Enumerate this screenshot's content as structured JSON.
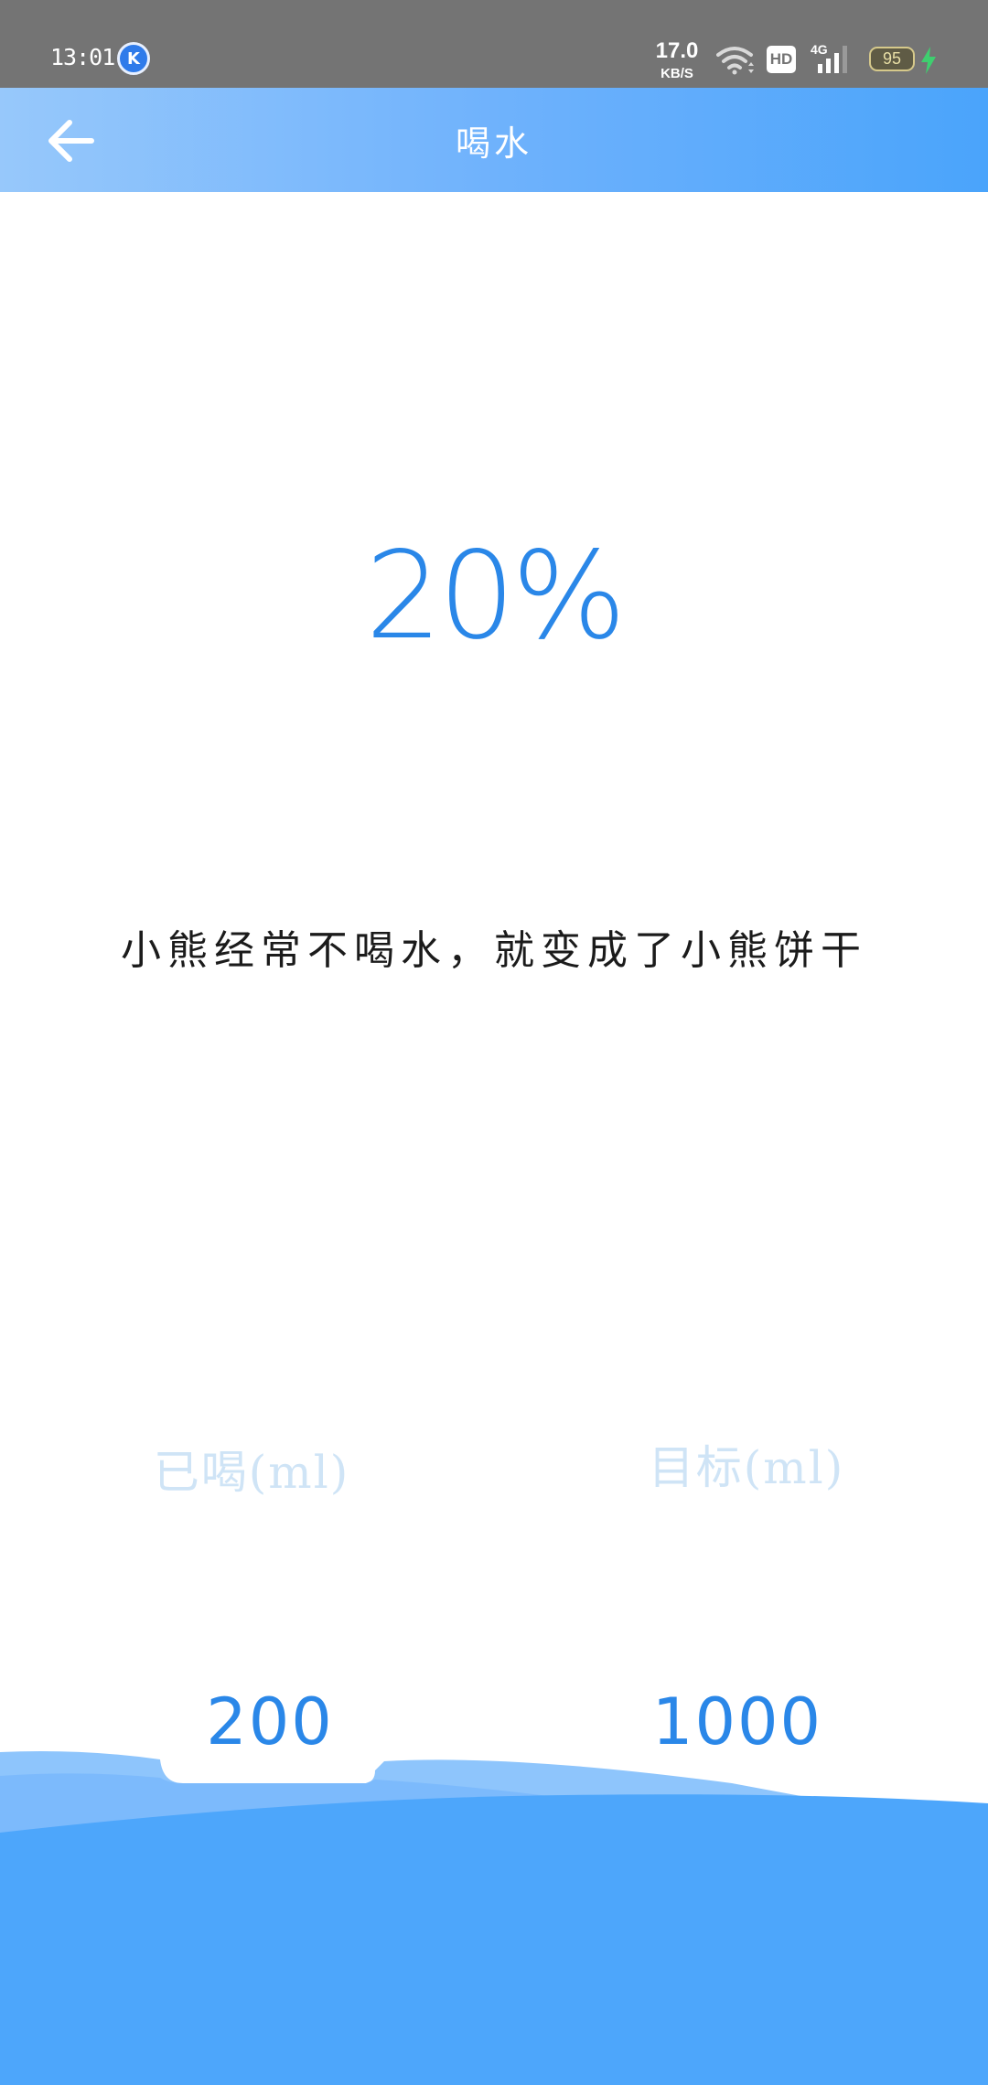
{
  "status_bar": {
    "time": "13:01",
    "app_icon_letter": "K",
    "net_speed_value": "17.0",
    "net_speed_unit": "KB/S",
    "hd_label": "HD",
    "signal_label": "4G",
    "battery_level": "95",
    "icons": [
      "wifi-icon",
      "signal-icon",
      "battery-icon",
      "charging-icon"
    ]
  },
  "app_bar": {
    "title": "喝水",
    "back_icon": "arrow-left-icon"
  },
  "progress": {
    "percent_text": "20%"
  },
  "message": "小熊经常不喝水，就变成了小熊饼干",
  "stats": {
    "drunk_label": "已喝(ml)",
    "drunk_value": "200",
    "target_label": "目标(ml)",
    "target_value": "1000"
  },
  "colors": {
    "accent": "#2a87e8",
    "app_bar_start": "#97c8fb",
    "app_bar_end": "#4aa4fb",
    "wave_light": "#8ec5fc",
    "wave_mid": "#78b8fc",
    "wave_deep": "#4da6fb",
    "label_faded": "#cfe4f6"
  }
}
